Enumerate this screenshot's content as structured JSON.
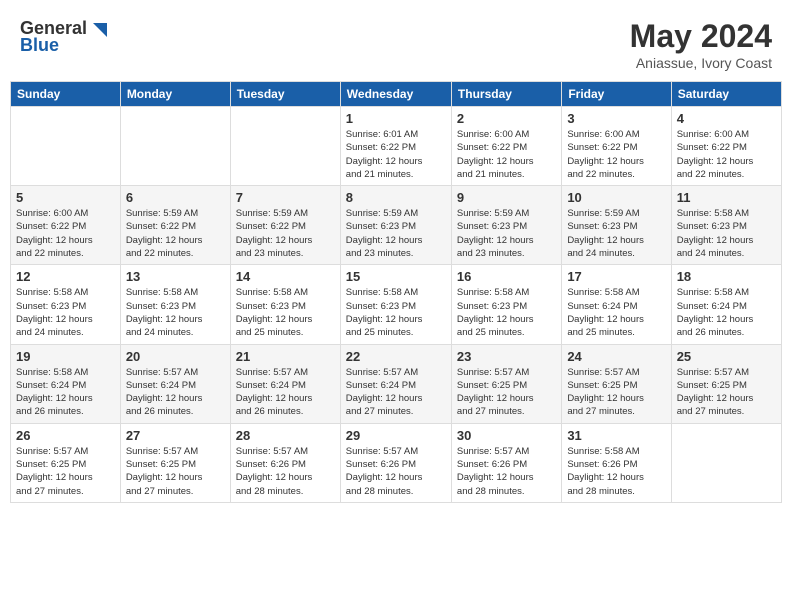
{
  "header": {
    "logo_general": "General",
    "logo_blue": "Blue",
    "month_year": "May 2024",
    "location": "Aniassue, Ivory Coast"
  },
  "weekdays": [
    "Sunday",
    "Monday",
    "Tuesday",
    "Wednesday",
    "Thursday",
    "Friday",
    "Saturday"
  ],
  "weeks": [
    [
      {
        "day": "",
        "info": ""
      },
      {
        "day": "",
        "info": ""
      },
      {
        "day": "",
        "info": ""
      },
      {
        "day": "1",
        "info": "Sunrise: 6:01 AM\nSunset: 6:22 PM\nDaylight: 12 hours\nand 21 minutes."
      },
      {
        "day": "2",
        "info": "Sunrise: 6:00 AM\nSunset: 6:22 PM\nDaylight: 12 hours\nand 21 minutes."
      },
      {
        "day": "3",
        "info": "Sunrise: 6:00 AM\nSunset: 6:22 PM\nDaylight: 12 hours\nand 22 minutes."
      },
      {
        "day": "4",
        "info": "Sunrise: 6:00 AM\nSunset: 6:22 PM\nDaylight: 12 hours\nand 22 minutes."
      }
    ],
    [
      {
        "day": "5",
        "info": "Sunrise: 6:00 AM\nSunset: 6:22 PM\nDaylight: 12 hours\nand 22 minutes."
      },
      {
        "day": "6",
        "info": "Sunrise: 5:59 AM\nSunset: 6:22 PM\nDaylight: 12 hours\nand 22 minutes."
      },
      {
        "day": "7",
        "info": "Sunrise: 5:59 AM\nSunset: 6:22 PM\nDaylight: 12 hours\nand 23 minutes."
      },
      {
        "day": "8",
        "info": "Sunrise: 5:59 AM\nSunset: 6:23 PM\nDaylight: 12 hours\nand 23 minutes."
      },
      {
        "day": "9",
        "info": "Sunrise: 5:59 AM\nSunset: 6:23 PM\nDaylight: 12 hours\nand 23 minutes."
      },
      {
        "day": "10",
        "info": "Sunrise: 5:59 AM\nSunset: 6:23 PM\nDaylight: 12 hours\nand 24 minutes."
      },
      {
        "day": "11",
        "info": "Sunrise: 5:58 AM\nSunset: 6:23 PM\nDaylight: 12 hours\nand 24 minutes."
      }
    ],
    [
      {
        "day": "12",
        "info": "Sunrise: 5:58 AM\nSunset: 6:23 PM\nDaylight: 12 hours\nand 24 minutes."
      },
      {
        "day": "13",
        "info": "Sunrise: 5:58 AM\nSunset: 6:23 PM\nDaylight: 12 hours\nand 24 minutes."
      },
      {
        "day": "14",
        "info": "Sunrise: 5:58 AM\nSunset: 6:23 PM\nDaylight: 12 hours\nand 25 minutes."
      },
      {
        "day": "15",
        "info": "Sunrise: 5:58 AM\nSunset: 6:23 PM\nDaylight: 12 hours\nand 25 minutes."
      },
      {
        "day": "16",
        "info": "Sunrise: 5:58 AM\nSunset: 6:23 PM\nDaylight: 12 hours\nand 25 minutes."
      },
      {
        "day": "17",
        "info": "Sunrise: 5:58 AM\nSunset: 6:24 PM\nDaylight: 12 hours\nand 25 minutes."
      },
      {
        "day": "18",
        "info": "Sunrise: 5:58 AM\nSunset: 6:24 PM\nDaylight: 12 hours\nand 26 minutes."
      }
    ],
    [
      {
        "day": "19",
        "info": "Sunrise: 5:58 AM\nSunset: 6:24 PM\nDaylight: 12 hours\nand 26 minutes."
      },
      {
        "day": "20",
        "info": "Sunrise: 5:57 AM\nSunset: 6:24 PM\nDaylight: 12 hours\nand 26 minutes."
      },
      {
        "day": "21",
        "info": "Sunrise: 5:57 AM\nSunset: 6:24 PM\nDaylight: 12 hours\nand 26 minutes."
      },
      {
        "day": "22",
        "info": "Sunrise: 5:57 AM\nSunset: 6:24 PM\nDaylight: 12 hours\nand 27 minutes."
      },
      {
        "day": "23",
        "info": "Sunrise: 5:57 AM\nSunset: 6:25 PM\nDaylight: 12 hours\nand 27 minutes."
      },
      {
        "day": "24",
        "info": "Sunrise: 5:57 AM\nSunset: 6:25 PM\nDaylight: 12 hours\nand 27 minutes."
      },
      {
        "day": "25",
        "info": "Sunrise: 5:57 AM\nSunset: 6:25 PM\nDaylight: 12 hours\nand 27 minutes."
      }
    ],
    [
      {
        "day": "26",
        "info": "Sunrise: 5:57 AM\nSunset: 6:25 PM\nDaylight: 12 hours\nand 27 minutes."
      },
      {
        "day": "27",
        "info": "Sunrise: 5:57 AM\nSunset: 6:25 PM\nDaylight: 12 hours\nand 27 minutes."
      },
      {
        "day": "28",
        "info": "Sunrise: 5:57 AM\nSunset: 6:26 PM\nDaylight: 12 hours\nand 28 minutes."
      },
      {
        "day": "29",
        "info": "Sunrise: 5:57 AM\nSunset: 6:26 PM\nDaylight: 12 hours\nand 28 minutes."
      },
      {
        "day": "30",
        "info": "Sunrise: 5:57 AM\nSunset: 6:26 PM\nDaylight: 12 hours\nand 28 minutes."
      },
      {
        "day": "31",
        "info": "Sunrise: 5:58 AM\nSunset: 6:26 PM\nDaylight: 12 hours\nand 28 minutes."
      },
      {
        "day": "",
        "info": ""
      }
    ]
  ]
}
